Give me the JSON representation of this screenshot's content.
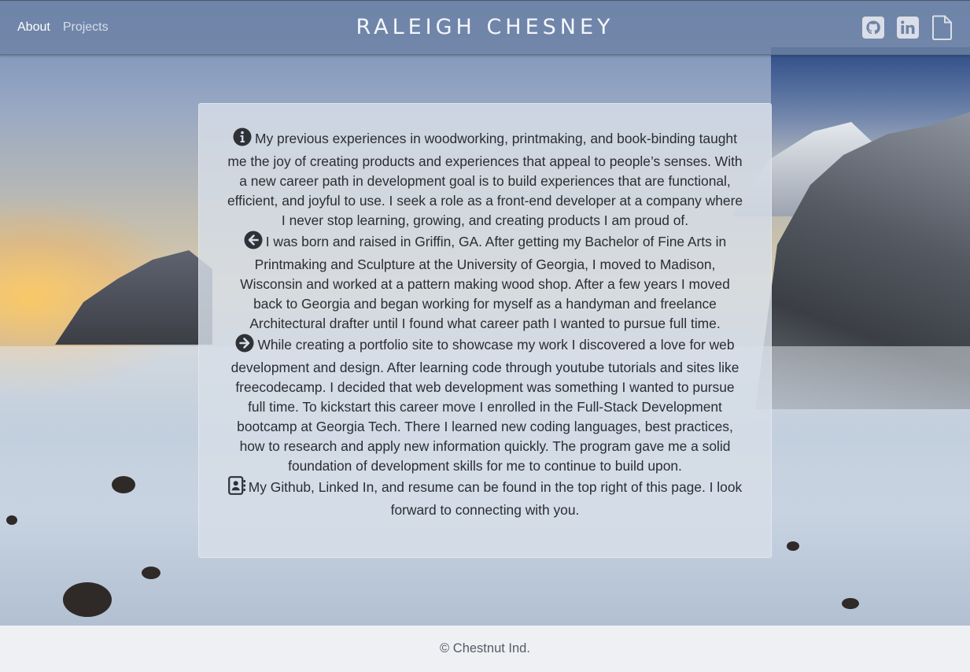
{
  "nav": {
    "items": [
      {
        "label": "About",
        "active": true
      },
      {
        "label": "Projects",
        "active": false
      }
    ]
  },
  "brand": {
    "title": "RALEIGH CHESNEY"
  },
  "social": {
    "icons": [
      "github-icon",
      "linkedin-icon",
      "resume-document-icon"
    ]
  },
  "about": {
    "paragraphs": [
      {
        "icon": "info-circle-icon",
        "text": "My previous experiences in woodworking, printmaking, and book-binding taught me the joy of creating products and experiences that appeal to people’s senses. With a new career path in development goal is to build experiences that are functional, efficient, and joyful to use. I seek a role as a front-end developer at a company where I never stop learning, growing, and creating products I am proud of."
      },
      {
        "icon": "arrow-left-circle-icon",
        "text": "I was born and raised in Griffin, GA. After getting my Bachelor of Fine Arts in Printmaking and Sculpture at the University of Georgia, I moved to Madison, Wisconsin and worked at a pattern making wood shop. After a few years I moved back to Georgia and began working for myself as a handyman and freelance Architectural drafter until I found what career path I wanted to pursue full time."
      },
      {
        "icon": "arrow-right-circle-icon",
        "text": "While creating a portfolio site to showcase my work I discovered a love for web development and design. After learning code through youtube tutorials and sites like freecodecamp. I decided that web development was something I wanted to pursue full time. To kickstart this career move I enrolled in the Full-Stack Development bootcamp at Georgia Tech. There I learned new coding languages, best practices, how to research and apply new information quickly. The program gave me a solid foundation of development skills for me to continue to build upon."
      },
      {
        "icon": "contact-card-icon",
        "text": "My Github, Linked In, and resume can be found in the top right of this page. I look forward to connecting with you."
      }
    ]
  },
  "footer": {
    "text": "© Chestnut Ind."
  },
  "colors": {
    "header_bg": "#6e82a5",
    "card_bg": "#d7dee8",
    "text": "#2a2d33",
    "footer_bg": "#eef0f3"
  }
}
